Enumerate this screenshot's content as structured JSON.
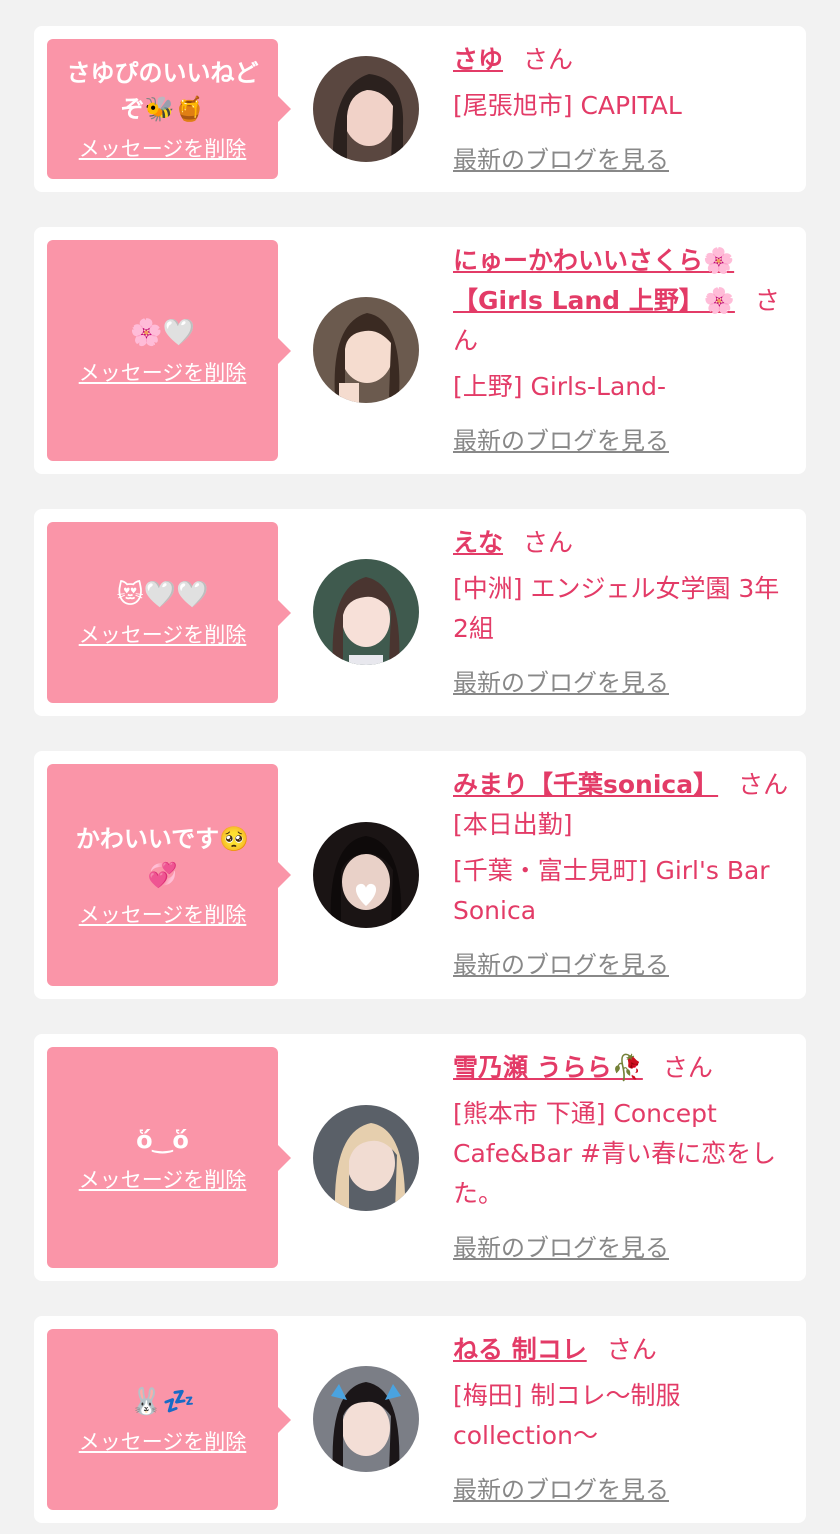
{
  "items": [
    {
      "message": "さゆぴのいいねど\nぞ🐝🍯",
      "delete_label": "メッセージを削除",
      "name": "さゆ",
      "suffix": "さん",
      "shop": "[尾張旭市] CAPITAL",
      "blog_label": "最新のブログを見る"
    },
    {
      "message": "🌸🤍",
      "delete_label": "メッセージを削除",
      "name": "にゅーかわいいさくら🌸【Girls Land 上野】🌸",
      "suffix": "さん",
      "shop": "[上野] Girls-Land-",
      "blog_label": "最新のブログを見る"
    },
    {
      "message": "😻🤍🤍",
      "delete_label": "メッセージを削除",
      "name": "えな",
      "suffix": "さん",
      "shop": "[中洲] エンジェル女学園 3年2組",
      "blog_label": "最新のブログを見る"
    },
    {
      "message": "かわいいです🥺\n💞",
      "delete_label": "メッセージを削除",
      "name": "みまり【千葉sonica】",
      "suffix": "さん[本日出勤]",
      "shop": "[千葉・富士見町] Girl's Bar Sonica",
      "blog_label": "最新のブログを見る"
    },
    {
      "message": "ὅ‿ὅ",
      "delete_label": "メッセージを削除",
      "name": "雪乃瀬 うらら🥀",
      "suffix": "さん",
      "shop": "[熊本市 下通] Concept Cafe&Bar #青い春に恋をした。",
      "blog_label": "最新のブログを見る"
    },
    {
      "message": "🐰💤",
      "delete_label": "メッセージを削除",
      "name": "ねる 制コレ",
      "suffix": "さん",
      "shop": "[梅田] 制コレ〜制服collection〜",
      "blog_label": "最新のブログを見る"
    }
  ],
  "colors": {
    "bubble": "#fa95a8",
    "accent": "#e33b67",
    "link_gray": "#888888",
    "background": "#f2f2f2"
  }
}
